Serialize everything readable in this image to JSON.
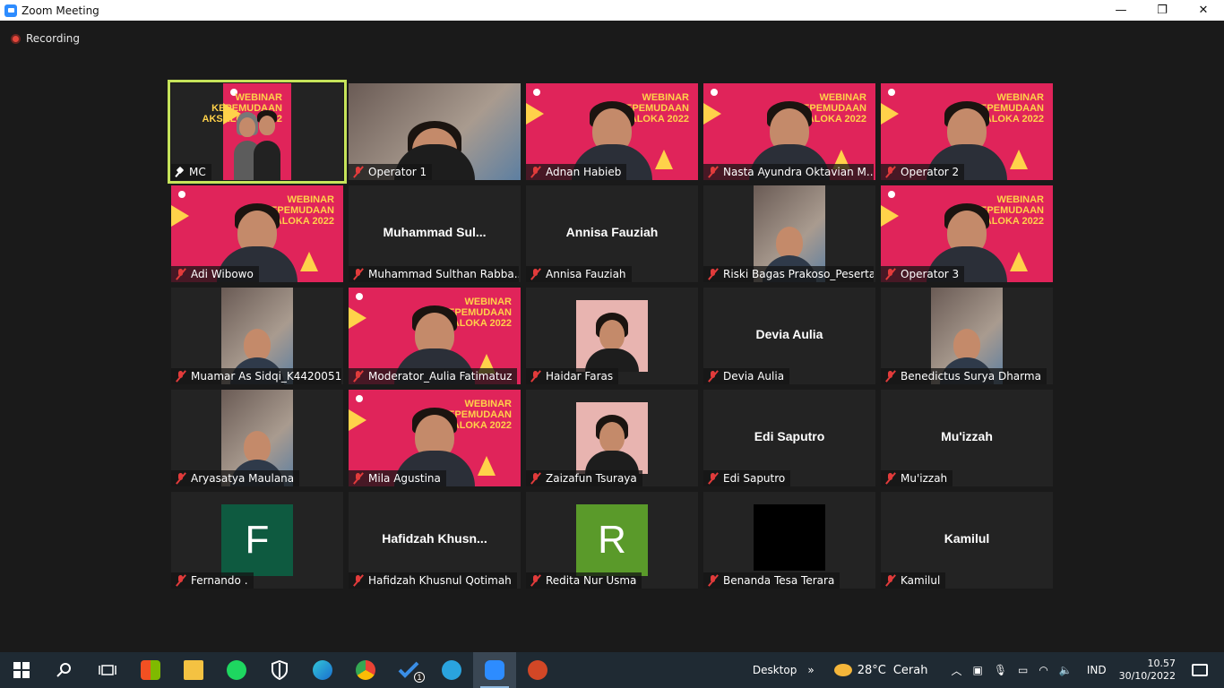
{
  "window": {
    "title": "Zoom Meeting",
    "minimize": "—",
    "maximize": "❐",
    "close": "✕"
  },
  "recording": {
    "label": "Recording"
  },
  "participants": [
    {
      "name": "MC",
      "type": "banner-duo",
      "active": true,
      "pinned": true
    },
    {
      "name": "Operator 1",
      "type": "room"
    },
    {
      "name": "Adnan Habieb",
      "type": "banner-person"
    },
    {
      "name": "Nasta Ayundra Oktavian M...",
      "type": "banner-person"
    },
    {
      "name": "Operator 2",
      "type": "banner-person"
    },
    {
      "name": "Adi Wibowo",
      "type": "banner-person"
    },
    {
      "name": "Muhammad Sulthan Rabba...",
      "type": "text",
      "display": "Muhammad  Sul..."
    },
    {
      "name": "Annisa Fauziah",
      "type": "text",
      "display": "Annisa Fauziah"
    },
    {
      "name": "Riski Bagas Prakoso_Peserta",
      "type": "small-cam"
    },
    {
      "name": "Operator 3",
      "type": "banner-person"
    },
    {
      "name": "Muamar As Sidqi_K4420051",
      "type": "small-cam"
    },
    {
      "name": "Moderator_Aulia Fatimatuz",
      "type": "banner-person"
    },
    {
      "name": "Haidar Faras",
      "type": "small-photo"
    },
    {
      "name": "Devia Aulia",
      "type": "text",
      "display": "Devia Aulia"
    },
    {
      "name": "Benedictus Surya Dharma",
      "type": "small-cam"
    },
    {
      "name": "Aryasatya Maulana",
      "type": "small-cam"
    },
    {
      "name": "Mila Agustina",
      "type": "banner-person"
    },
    {
      "name": "Zaizafun Tsuraya",
      "type": "small-photo"
    },
    {
      "name": "Edi Saputro",
      "type": "text",
      "display": "Edi Saputro"
    },
    {
      "name": "Mu'izzah",
      "type": "text",
      "display": "Mu'izzah"
    },
    {
      "name": "Fernando .",
      "type": "letter",
      "letter": "F",
      "color": "#0e5a40"
    },
    {
      "name": "Hafidzah Khusnul Qotimah",
      "type": "text",
      "display": "Hafidzah  Khusn..."
    },
    {
      "name": "Redita Nur Usma",
      "type": "letter",
      "letter": "R",
      "color": "#5a9a2a"
    },
    {
      "name": "Benanda Tesa Terara",
      "type": "black"
    },
    {
      "name": "Kamilul",
      "type": "text",
      "display": "Kamilul"
    }
  ],
  "banner_text": "WEBINAR KEPEMUDAAN AKSALOKA 2022",
  "taskbar": {
    "desktop_label": "Desktop",
    "weather_temp": "28°C",
    "weather_desc": "Cerah",
    "language": "IND",
    "time": "10.57",
    "date": "30/10/2022",
    "todo_badge": "1"
  }
}
